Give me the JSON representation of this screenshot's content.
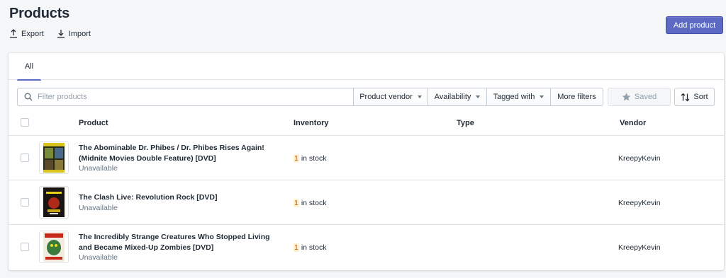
{
  "page": {
    "title": "Products",
    "export_label": "Export",
    "import_label": "Import",
    "add_product_label": "Add product"
  },
  "tabs": [
    {
      "label": "All",
      "selected": true
    }
  ],
  "filters": {
    "search_placeholder": "Filter products",
    "search_value": "",
    "product_vendor": "Product vendor",
    "availability": "Availability",
    "tagged_with": "Tagged with",
    "more_filters": "More filters",
    "saved": "Saved",
    "sort": "Sort"
  },
  "table": {
    "columns": [
      "Product",
      "Inventory",
      "Type",
      "Vendor"
    ],
    "rows": [
      {
        "name_line1": "The Abominable Dr. Phibes / Dr. Phibes Rises Again!",
        "name_line2": "(Midnite Movies Double Feature) [DVD]",
        "status": "Unavailable",
        "stock_count": "1",
        "stock_text": "in stock",
        "type": "",
        "vendor": "KreepyKevin"
      },
      {
        "name_line1": "The Clash Live: Revolution Rock [DVD]",
        "name_line2": "",
        "status": "Unavailable",
        "stock_count": "1",
        "stock_text": "in stock",
        "type": "",
        "vendor": "KreepyKevin"
      },
      {
        "name_line1": "The Incredibly Strange Creatures Who Stopped Living",
        "name_line2": "and Became Mixed-Up Zombies [DVD]",
        "status": "Unavailable",
        "stock_count": "1",
        "stock_text": "in stock",
        "type": "",
        "vendor": "KreepyKevin"
      }
    ]
  },
  "colors": {
    "primary": "#5c6ac4",
    "background": "#f4f6f8",
    "stock_highlight_bg": "#fcf1cd",
    "stock_highlight_text": "#c05717"
  },
  "icons": {
    "export": "export-icon",
    "import": "import-icon",
    "search": "search-icon",
    "caret": "caret-down-icon",
    "saved": "star-icon",
    "sort": "sort-icon"
  }
}
